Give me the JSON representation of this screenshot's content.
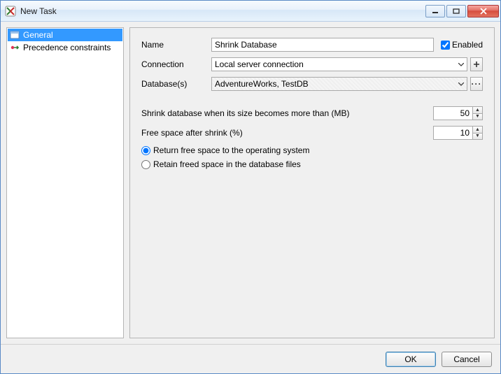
{
  "window": {
    "title": "New Task"
  },
  "sidebar": {
    "items": [
      {
        "label": "General",
        "selected": true
      },
      {
        "label": "Precedence constraints",
        "selected": false
      }
    ]
  },
  "form": {
    "name_label": "Name",
    "name_value": "Shrink Database",
    "enabled_label": "Enabled",
    "enabled_checked": true,
    "connection_label": "Connection",
    "connection_value": "Local server connection",
    "databases_label": "Database(s)",
    "databases_value": "AdventureWorks, TestDB",
    "shrink_threshold_label": "Shrink database when its size becomes more than (MB)",
    "shrink_threshold_value": "50",
    "free_space_label": "Free space after shrink (%)",
    "free_space_value": "10",
    "radio_return_label": "Return free space to the operating system",
    "radio_retain_label": "Retain freed space in the database files",
    "radio_selected": "return"
  },
  "footer": {
    "ok_label": "OK",
    "cancel_label": "Cancel"
  }
}
